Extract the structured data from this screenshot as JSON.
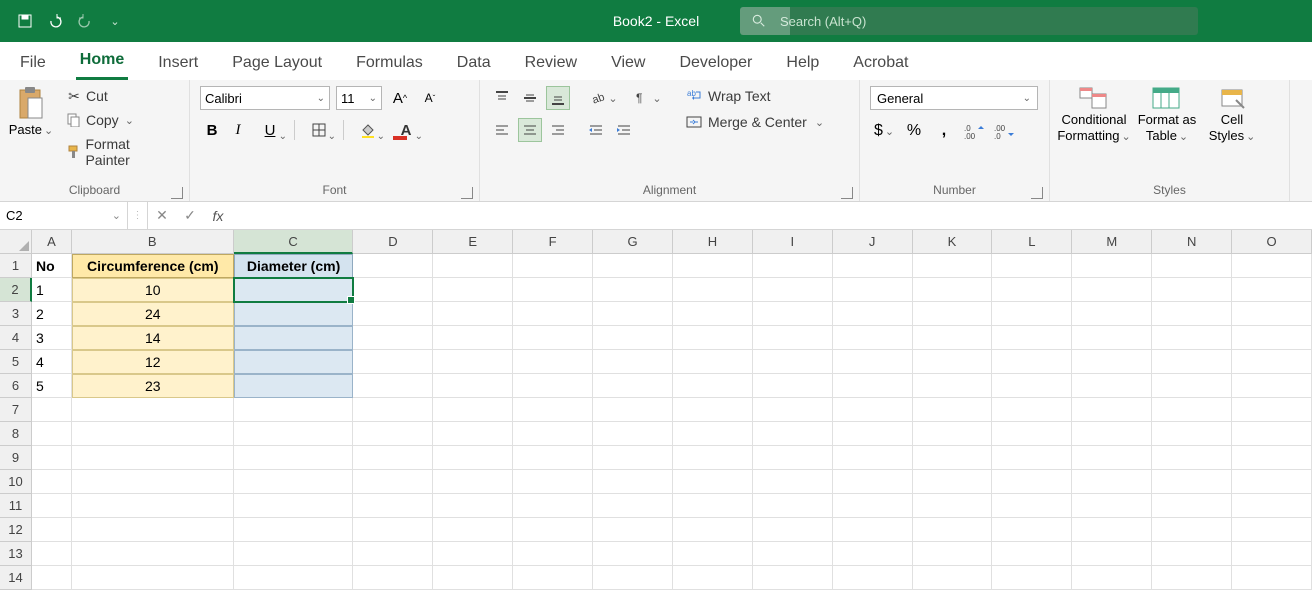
{
  "titlebar": {
    "title": "Book2  -  Excel",
    "search_placeholder": "Search (Alt+Q)"
  },
  "tabs": [
    "File",
    "Home",
    "Insert",
    "Page Layout",
    "Formulas",
    "Data",
    "Review",
    "View",
    "Developer",
    "Help",
    "Acrobat"
  ],
  "active_tab": "Home",
  "ribbon": {
    "clipboard": {
      "paste": "Paste",
      "cut": "Cut",
      "copy": "Copy",
      "format_painter": "Format Painter",
      "label": "Clipboard"
    },
    "font": {
      "name": "Calibri",
      "size": "11",
      "label": "Font"
    },
    "alignment": {
      "wrap": "Wrap Text",
      "merge": "Merge & Center",
      "label": "Alignment"
    },
    "number": {
      "format": "General",
      "label": "Number"
    },
    "styles": {
      "cond": "Conditional Formatting",
      "table": "Format as Table",
      "cell": "Cell Styles",
      "label": "Styles"
    }
  },
  "namebox": "C2",
  "columns": [
    "A",
    "B",
    "C",
    "D",
    "E",
    "F",
    "G",
    "H",
    "I",
    "J",
    "K",
    "L",
    "M",
    "N",
    "O"
  ],
  "row_numbers": [
    "1",
    "2",
    "3",
    "4",
    "5",
    "6",
    "7",
    "8",
    "9",
    "10",
    "11",
    "12",
    "13",
    "14"
  ],
  "data": {
    "A1": "No",
    "B1": "Circumference (cm)",
    "C1": "Diameter (cm)",
    "A2": "1",
    "B2": "10",
    "A3": "2",
    "B3": "24",
    "A4": "3",
    "B4": "14",
    "A5": "4",
    "B5": "12",
    "A6": "5",
    "B6": "23"
  },
  "active_cell": "C2"
}
